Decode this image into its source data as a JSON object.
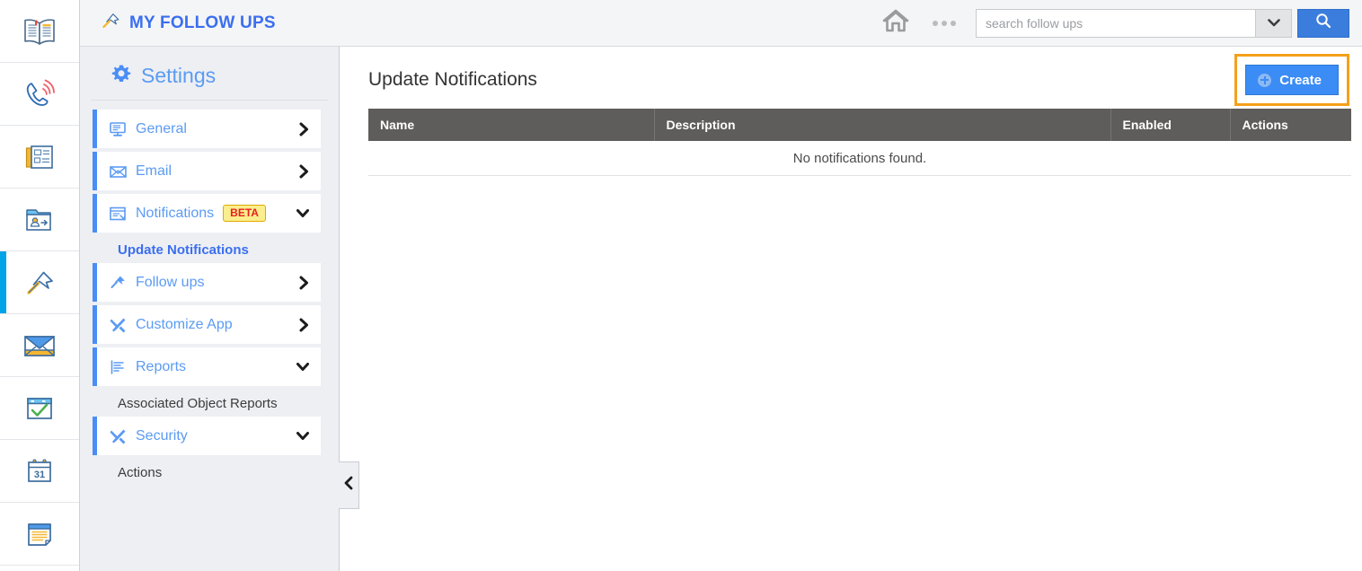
{
  "icon_rail": {
    "items": [
      {
        "name": "book-icon",
        "label": "Knowledge Base",
        "active": false
      },
      {
        "name": "phone-ringing-icon",
        "label": "Calls",
        "active": false
      },
      {
        "name": "news-article-icon",
        "label": "News",
        "active": false
      },
      {
        "name": "contact-folder-icon",
        "label": "Contacts",
        "active": false
      },
      {
        "name": "pushpin-icon",
        "label": "Follow Ups",
        "active": true
      },
      {
        "name": "envelope-icon",
        "label": "Mail",
        "active": false
      },
      {
        "name": "checklist-window-icon",
        "label": "Tasks",
        "active": false
      },
      {
        "name": "calendar-31-icon",
        "label": "Calendar",
        "active": false
      },
      {
        "name": "notes-icon",
        "label": "Notes",
        "active": false
      }
    ]
  },
  "topbar": {
    "title": "MY FOLLOW UPS",
    "title_icon": "pushpin-icon",
    "home_icon": "home-icon",
    "more_icon": "ellipsis-icon",
    "search": {
      "placeholder": "search follow ups",
      "value": "",
      "dropdown_icon": "chevron-down-icon",
      "submit_icon": "search-icon"
    }
  },
  "settings": {
    "heading": "Settings",
    "heading_icon": "gear-icon",
    "menu": [
      {
        "label": "General",
        "icon": "monitor-icon",
        "state": "collapsed",
        "chevron": "chevron-right-icon"
      },
      {
        "label": "Email",
        "icon": "open-envelope-icon",
        "state": "collapsed",
        "chevron": "chevron-right-icon"
      },
      {
        "label": "Notifications",
        "icon": "notification-window-icon",
        "state": "expanded",
        "chevron": "chevron-down-icon",
        "badge": "BETA"
      },
      {
        "label": "Follow ups",
        "icon": "pushpin-icon",
        "state": "collapsed",
        "chevron": "chevron-right-icon"
      },
      {
        "label": "Customize App",
        "icon": "tools-icon",
        "state": "collapsed",
        "chevron": "chevron-right-icon"
      },
      {
        "label": "Reports",
        "icon": "report-lines-icon",
        "state": "expanded",
        "chevron": "chevron-down-icon"
      },
      {
        "label": "Security",
        "icon": "tools-icon",
        "state": "expanded",
        "chevron": "chevron-down-icon"
      }
    ],
    "sub_notifications": "Update Notifications",
    "sub_reports": "Associated Object Reports",
    "sub_security": "Actions",
    "collapse_icon": "chevron-left-icon"
  },
  "main": {
    "page_title": "Update Notifications",
    "create_button": {
      "label": "Create",
      "icon": "plus-circle-icon",
      "highlighted": true
    },
    "table": {
      "columns": [
        "Name",
        "Description",
        "Enabled",
        "Actions"
      ],
      "rows": [],
      "empty_message": "No notifications found."
    }
  },
  "colors": {
    "accent_blue": "#3b7ddd",
    "link_blue": "#5b9bf3",
    "title_blue": "#3b6ef0",
    "rail_active": "#00a3e8",
    "highlight_orange": "#f5a01a",
    "table_header": "#5e5d5c",
    "badge_yellow": "#fbee8c",
    "badge_red": "#e8201f",
    "sidebar_bg": "#edeff3"
  }
}
